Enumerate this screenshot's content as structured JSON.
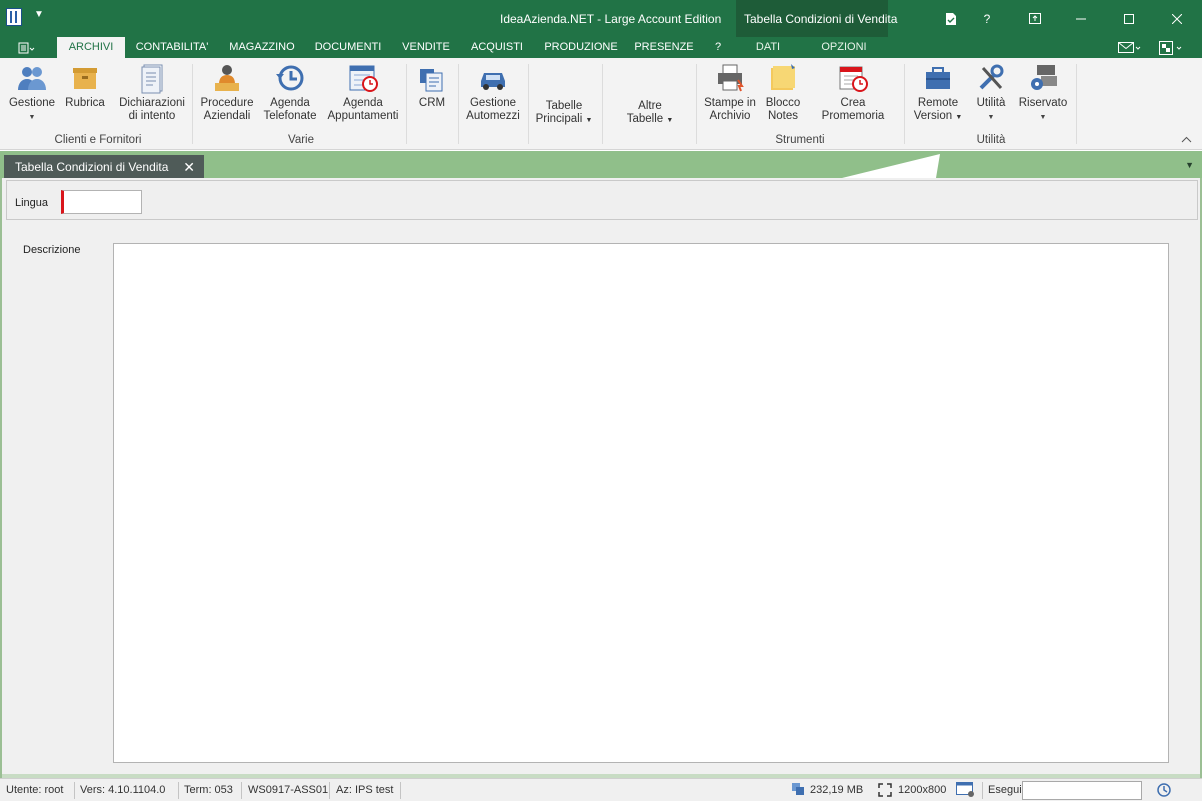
{
  "titlebar": {
    "title": "IdeaAzienda.NET - Large Account Edition",
    "context_title": "Tabella Condizioni di Vendita",
    "qat_icon": "quick-access-dropdown",
    "help": "?"
  },
  "ribbon_tabs": [
    "ARCHIVI",
    "CONTABILITA'",
    "MAGAZZINO",
    "DOCUMENTI",
    "VENDITE",
    "ACQUISTI",
    "PRODUZIONE",
    "PRESENZE",
    "?"
  ],
  "context_tabs": [
    "DATI",
    "OPZIONI"
  ],
  "ribbon": {
    "gestione": "Gestione",
    "rubrica": "Rubrica",
    "dichiarazioni_1": "Dichiarazioni",
    "dichiarazioni_2": "di intento",
    "group_clienti": "Clienti e Fornitori",
    "procedure_1": "Procedure",
    "procedure_2": "Aziendali",
    "agenda_tel_1": "Agenda",
    "agenda_tel_2": "Telefonate",
    "agenda_app_1": "Agenda",
    "agenda_app_2": "Appuntamenti",
    "group_varie": "Varie",
    "crm": "CRM",
    "automezzi_1": "Gestione",
    "automezzi_2": "Automezzi",
    "tabelle_1": "Tabelle",
    "tabelle_2": "Principali",
    "altre_1": "Altre",
    "altre_2": "Tabelle",
    "stampe_1": "Stampe in",
    "stampe_2": "Archivio",
    "blocco_1": "Blocco",
    "blocco_2": "Notes",
    "promemoria": "Crea Promemoria",
    "group_strumenti": "Strumenti",
    "remote_1": "Remote",
    "remote_2": "Version",
    "utilita": "Utilità",
    "riservato": "Riservato",
    "group_utilita": "Utilità"
  },
  "document_tab": {
    "title": "Tabella Condizioni di Vendita",
    "close": "✕"
  },
  "form": {
    "lingua_label": "Lingua",
    "lingua_value": "",
    "descrizione_label": "Descrizione",
    "descrizione_value": ""
  },
  "status": {
    "utente": "Utente: root",
    "versione": "Vers: 4.10.1104.0",
    "terminale": "Term: 053",
    "workstation": "WS0917-ASS01",
    "azienda": "Az: IPS test",
    "memoria": "232,19 MB",
    "risoluzione": "1200x800",
    "esegui": "Esegui"
  },
  "colors": {
    "accent": "#217346",
    "strip": "#90bf8a",
    "doc_tab": "#4f5b58",
    "required_marker": "#d9151b"
  }
}
